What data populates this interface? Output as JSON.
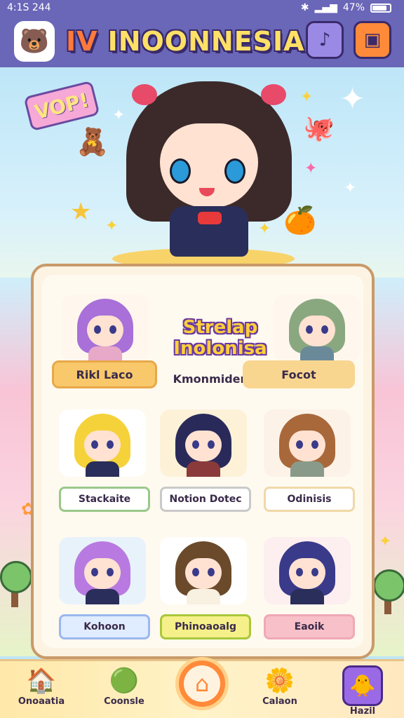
{
  "status_bar": {
    "time": "4:1S 244",
    "battery": "47%",
    "signal_icon": "signal-icon",
    "bluetooth_icon": "bluetooth-icon"
  },
  "header": {
    "title_prefix": "IV",
    "title": "INOONNESIA",
    "logo_icon": "bear-face-icon",
    "button1_icon": "music-note-icon",
    "button2_icon": "profile-card-icon"
  },
  "hero": {
    "speech_bubble": "VOP!"
  },
  "card": {
    "title_line1": "Strelap",
    "title_line2": "Inolonisa",
    "top_labels": [
      "Rikl Laco",
      "Kmonmidend",
      "Focot"
    ],
    "characters": [
      {
        "label": "Stackaite",
        "hair": "#f6d23a",
        "accent": "#9ac88a"
      },
      {
        "label": "Notion Dotec",
        "hair": "#2a2a5a",
        "accent": "#c9c9c9"
      },
      {
        "label": "Odinisis",
        "hair": "#a8683a",
        "accent": "#f0d8a8"
      },
      {
        "label": "Kohoon",
        "hair": "#b87ae0",
        "accent": "#9ab8f0"
      },
      {
        "label": "Phinoaoalg",
        "hair": "#6a4a2a",
        "accent": "#d8e86a"
      },
      {
        "label": "Eaoik",
        "hair": "#3a3a8a",
        "accent": "#f0a8b8"
      }
    ]
  },
  "nav": {
    "items": [
      {
        "label": "Onoaatia",
        "icon": "house-icon"
      },
      {
        "label": "Coonsle",
        "icon": "green-blob-icon"
      },
      {
        "label": "Calaon",
        "icon": "flower-creature-icon"
      },
      {
        "label": "Hazil",
        "icon": "badge-icon"
      }
    ],
    "home_icon": "home-icon"
  }
}
